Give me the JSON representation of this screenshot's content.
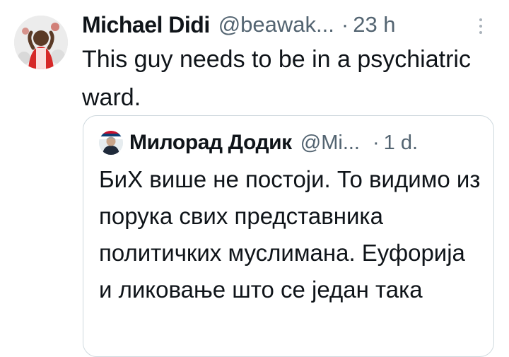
{
  "tweet": {
    "author_name": "Michael Didi",
    "handle": "@beawak...",
    "separator": "·",
    "time": "23 h",
    "text": "This guy needs to be in a psychiatric ward."
  },
  "quoted_tweet": {
    "author_name": "Милорад Додик",
    "handle": "@Mi...",
    "separator": "·",
    "time": "1 d.",
    "text": "БиХ више не постоји. То видимо из порука свих представника политичких муслимана. Еуфорија и ликовање што се један така"
  },
  "icons": {
    "more": "more-options-icon",
    "avatar": "profile-avatar",
    "quoted_avatar": "quoted-profile-avatar"
  },
  "colors": {
    "text_primary": "#0f1419",
    "text_secondary": "#536471",
    "border": "#cfd9de"
  }
}
